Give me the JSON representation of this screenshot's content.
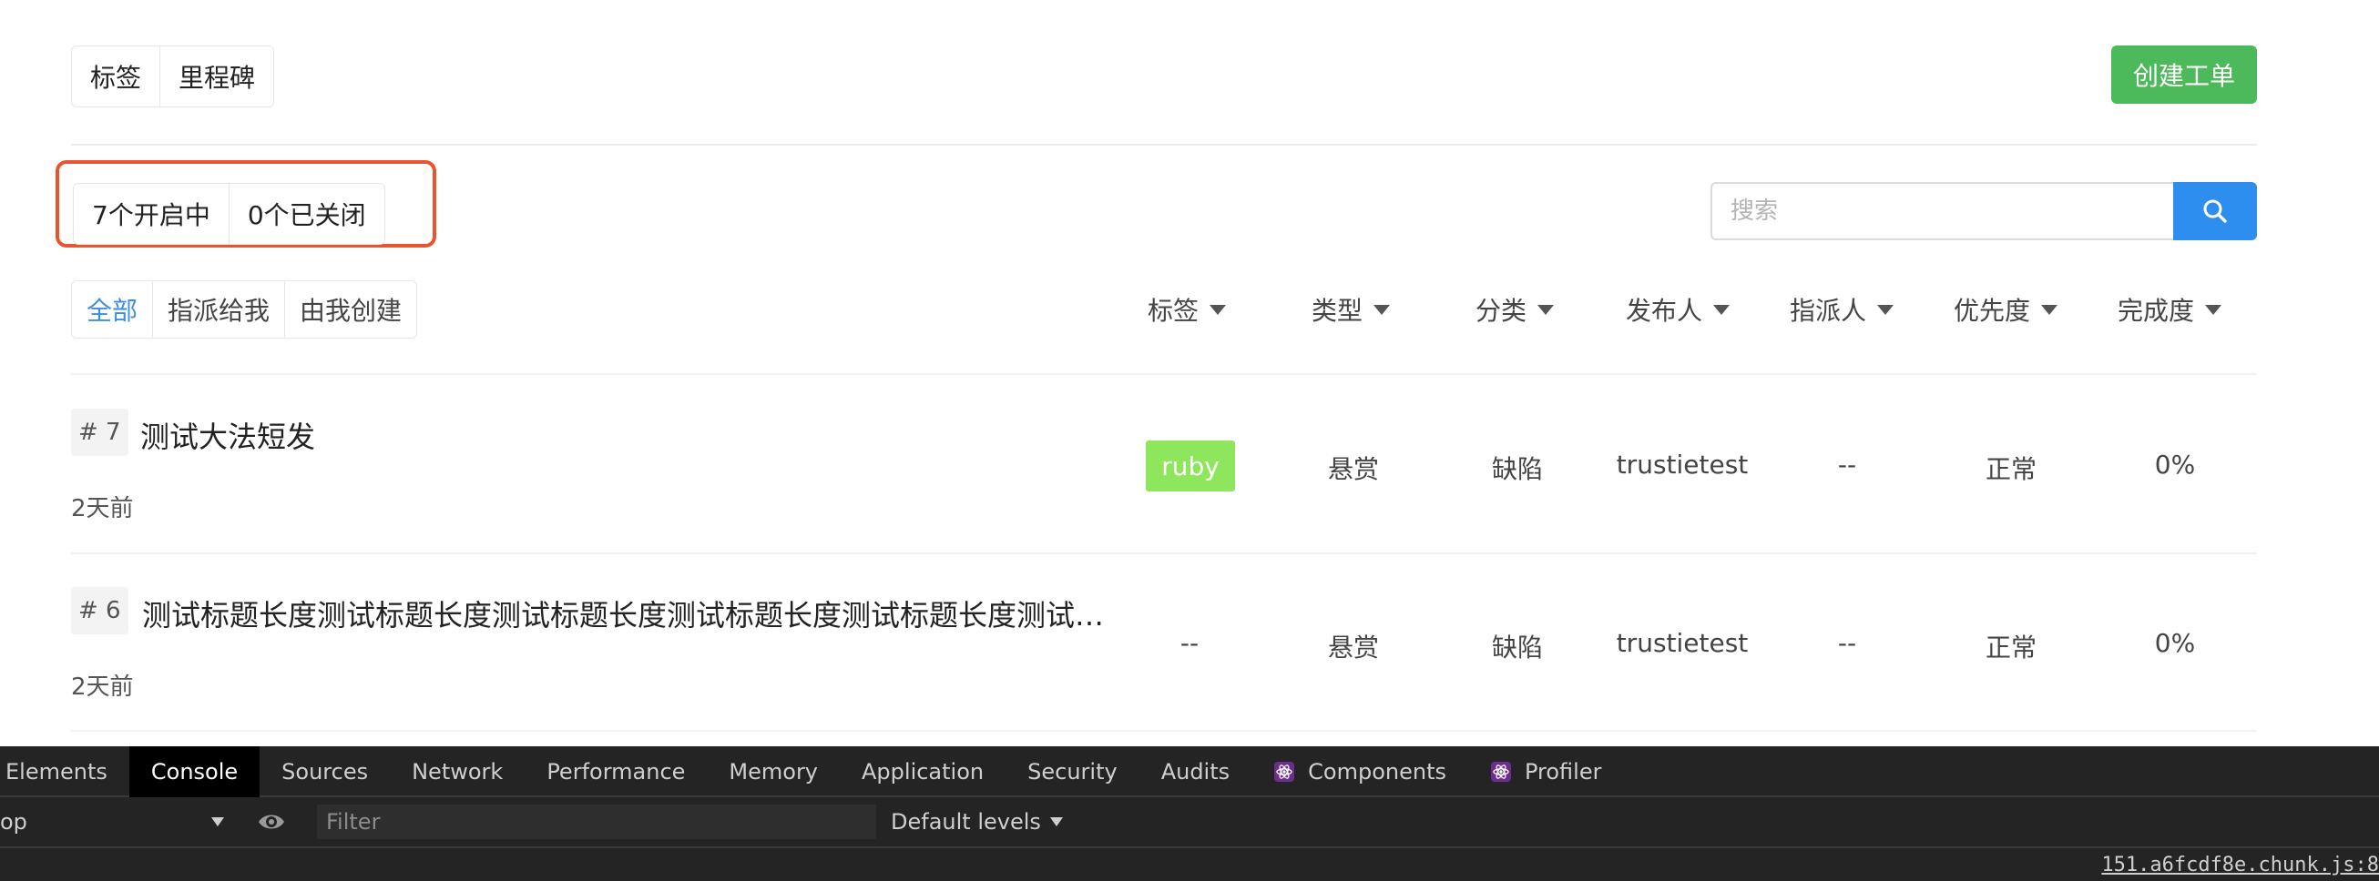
{
  "top_tabs": [
    "标签",
    "里程碑"
  ],
  "create_button": "创建工单",
  "status_tabs": [
    "7个开启中",
    "0个已关闭"
  ],
  "search": {
    "placeholder": "搜索"
  },
  "filter_tabs": [
    "全部",
    "指派给我",
    "由我创建"
  ],
  "column_filters": [
    "标签",
    "类型",
    "分类",
    "发布人",
    "指派人",
    "优先度",
    "完成度"
  ],
  "issues": [
    {
      "number": "# 7",
      "title": "测试大法短发",
      "time": "2天前",
      "label": "ruby",
      "type": "悬赏",
      "category": "缺陷",
      "author": "trustietest",
      "assignee": "--",
      "priority": "正常",
      "progress": "0%"
    },
    {
      "number": "# 6",
      "title": "测试标题长度测试标题长度测试标题长度测试标题长度测试标题长度测试…",
      "time": "2天前",
      "label": "--",
      "type": "悬赏",
      "category": "缺陷",
      "author": "trustietest",
      "assignee": "--",
      "priority": "正常",
      "progress": "0%"
    }
  ],
  "colors": {
    "create_button": "#4cb95a",
    "search_button": "#2e8ef0",
    "highlight": "#e8542f",
    "label_ruby": "#8ee65c",
    "active_filter": "#3a8ee6"
  },
  "devtools": {
    "tabs": [
      "Elements",
      "Console",
      "Sources",
      "Network",
      "Performance",
      "Memory",
      "Application",
      "Security",
      "Audits",
      "Components",
      "Profiler"
    ],
    "active_tab": "Console",
    "context": "op",
    "filter_placeholder": "Filter",
    "levels": "Default levels",
    "source_link": "151.a6fcdf8e.chunk.js:8"
  }
}
